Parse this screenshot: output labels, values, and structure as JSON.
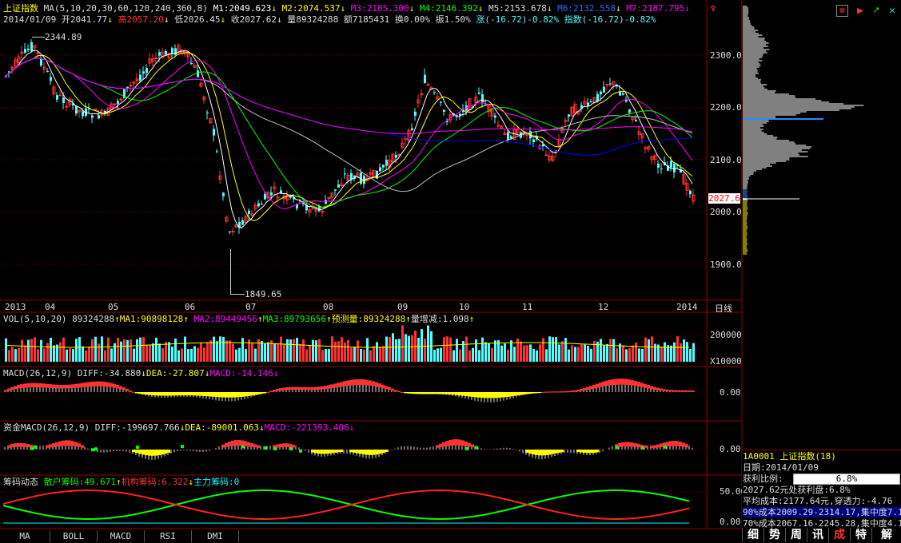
{
  "header": {
    "title": "上证指数",
    "ma_label": "MA(5,10,20,30,60,120,240,360,8)",
    "m1": "M1:2049.623",
    "m2": "M2:2074.537",
    "m3": "M3:2105.300",
    "m4": "M4:2146.392",
    "m5": "M5:2153.678",
    "m6": "M6:2132.558",
    "m7": "M7:2187.795",
    "date": "2014/01/09",
    "open": "开2041.77",
    "high": "高2057.20",
    "low": "低2026.45",
    "close": "收2027.62",
    "volume": "量89324288",
    "amount": "额7185431",
    "turnover": "换0.00%",
    "amplitude": "振1.50%",
    "change": "涨(-16.72)-0.82%",
    "index": "指数(-16.72)-0.82%"
  },
  "price_chart": {
    "max_label": "2344.89",
    "min_label": "1849.65",
    "last_label": "2027.6",
    "y_ticks": [
      "2300.0",
      "2200.0",
      "2100.0",
      "2000.0",
      "1900.0"
    ],
    "x_ticks": [
      "2013",
      "04",
      "05",
      "06",
      "07",
      "08",
      "09",
      "10",
      "11",
      "12",
      "2014"
    ],
    "period_label": "日线"
  },
  "vol_panel": {
    "label": "VOL(5,10,20)",
    "value": "89324288",
    "ma1": "MA1:90898128",
    "ma2": "MA2:89449456",
    "ma3": "MA3:89793656",
    "forecast": "预测量:89324288",
    "change": "量增减:1.098",
    "y_tick": "200000",
    "unit": "X10000"
  },
  "macd_panel": {
    "label": "MACD(26,12,9)",
    "diff": "DIFF:-34.880",
    "dea": "DEA:-27.807",
    "macd": "MACD:-14.146",
    "y_tick": "0.00"
  },
  "fund_macd_panel": {
    "label": "资金MACD(26,12,9)",
    "diff": "DIFF:-199697.766",
    "dea": "DEA:-89001.063",
    "macd": "MACD:-221393.406",
    "y_tick": "0.00"
  },
  "chips_panel": {
    "label": "筹码动态",
    "retail": "散户筹码:49.671",
    "institution": "机构筹码:6.322",
    "main": "主力筹码:0",
    "y_tick_top": "50.00",
    "y_tick_bottom": "0.00"
  },
  "bottom_tabs": [
    "MA",
    "BOLL",
    "MACD",
    "RSI",
    "DMI"
  ],
  "side_info": {
    "code_name": "1A0001  上证指数(18)",
    "date": "日期:2014/01/09",
    "profit_ratio_label": "获利比例:",
    "profit_ratio_value": "6.8%",
    "line1": "2027.62元处获利盘:6.8%",
    "line2": "平均成本:2177.64元,穿透力:-4.76",
    "line3": "90%成本2009.29-2314.17,集中度7.1",
    "line4": "70%成本2067.16-2245.28,集中度4.1"
  },
  "side_tabs": [
    "细",
    "势",
    "周",
    "讯",
    "成",
    "特",
    "解"
  ],
  "colors": {
    "up": "#ff3232",
    "down": "#54fcfc",
    "grid": "#8b0000",
    "ma5": "#ffffff",
    "ma10": "#ffff00",
    "ma20": "#ff00ff",
    "ma30": "#00ff00",
    "ma60": "#c0c0c0",
    "ma120": "#0000ff",
    "ma240": "#ff00ff"
  }
}
